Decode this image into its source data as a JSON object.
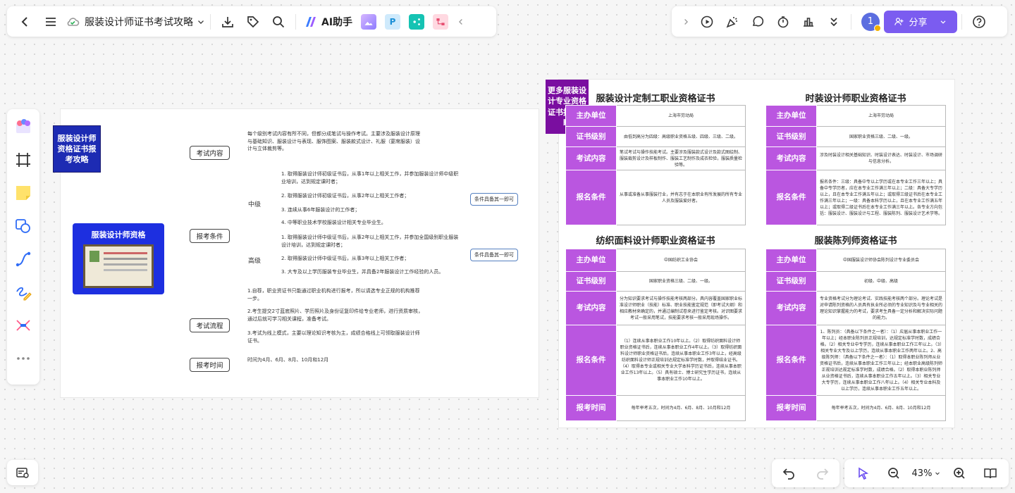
{
  "topbar": {
    "doc_title": "服装设计师证书考试攻略",
    "ai_label": "AI助手",
    "app_p_label": "P",
    "share_label": "分享",
    "avatar_text": "1"
  },
  "zoom": {
    "value": "43%"
  },
  "mindmap": {
    "tag": "服装设计师资格证书报考攻略",
    "root": "服装设计师资格",
    "branches": [
      "考试内容",
      "报考条件",
      "考试流程",
      "报考时间"
    ],
    "content_text": "每个级别考试内容有所不同，但都分成笔试与操作考试。主要涉及服装设计原理与基础知识、服装设计与表现、服饰图案、服装款式设计、礼服（宴席服装）设计与立体裁剪等。",
    "levels": [
      "中级",
      "高级"
    ],
    "mid_items": [
      "1. 取得服装设计师初级证书后，从事1年以上相关工作，并参加服装设计师中级职业培训，达到规定课时者；",
      "2. 取得服装设计师初级证书后，从事2年以上相关工作者；",
      "3. 连续从事6年服装设计的工作者；",
      "4. 中等职业技术学校服装设计相关专业毕业生。"
    ],
    "high_items": [
      "1. 取得服装设计师中级证书后，从事2年以上相关工作，并参加全国级别职业服装设计培训，达到规定课时者；",
      "2. 取得服装设计师中级证书后，从事3年以上相关工作者；",
      "3. 大专及以上学历服装专业毕业生，并具备2年服装设计工作经验的人员。"
    ],
    "pill_mid": "条件具备其一即可",
    "pill_high": "条件具备其一即可",
    "process_items": [
      "1.自荐，职业资证书只能通过职业机构进行报考，所以请选专业正规的机构推荐一步。",
      "2.考生提交2寸蓝底照片、学历照片及身份证复印件给专业老师，进行资质审核，通过后就可学习相关课程，准备考试。",
      "3.考试为线上模式，主要以理论知识考核为主，成绩合格线上可领取服装设计师证书。"
    ],
    "time_text": "时间为4月、6月、8月、10月和12月"
  },
  "certs": {
    "tag": "更多服装设计专业资格证书报考攻略",
    "tables": [
      {
        "title": "服装设计定制工职业资格证书",
        "rows": [
          {
            "label": "主办单位",
            "value": "上海市劳动局"
          },
          {
            "label": "证书级别",
            "value": "由低到高分为四级：高级职业资格五级、四级、三级、二级。"
          },
          {
            "label": "考试内容",
            "value": "笔试考试与操作技能考试。主要涉及服装款式设计及款式图绘制、服装裁剪设计及样板制作、服装工艺制作及成衣检验，服装质量检验等。"
          },
          {
            "label": "报名条件",
            "value": "从事或准备从事服装行业，并有志于在本职业有所发展的所有专业人员及服装爱好者。"
          }
        ]
      },
      {
        "title": "时装设计师职业资格证书",
        "rows": [
          {
            "label": "主办单位",
            "value": "上海市劳动局"
          },
          {
            "label": "证书级别",
            "value": "国家职业资格三级、二级、一级。"
          },
          {
            "label": "考试内容",
            "value": "涉及时装设计相关基础知识、时装设计表达、时装设计、市场调研与信息分析。"
          },
          {
            "label": "报名条件",
            "value": "报名条件：三级：具备中专以上学历或在本专业工作三年以上；具备中专学历者，应在本专业工作满三年以上；二级：具备大专学历以上，且在本专业工作满五年以上；或取得三级证书后在本专业工作满三年以上；一级：具备本科学历以上，且在本专业工作满五年以上；或取得二级证书后在本专业工作满三年以上。各专业方向包括：服装设计、服装设计与工程、服装陈列、服装设计艺术学等。"
          }
        ]
      },
      {
        "title": "纺织面料设计师职业资格证书",
        "rows": [
          {
            "label": "主办单位",
            "value": "中国纺织工业协会"
          },
          {
            "label": "证书级别",
            "value": "国家职业资格三级、二级、一级。"
          },
          {
            "label": "考试内容",
            "value": "分为知识要求考试与操作技能考核两部分。具内容覆盖国家职业标准设计师职业（技能）标准、职业技能鉴定规范（即考试大纲）和相应教材来确定的，并通过编制试卷来进行鉴定考核。对识图要求考试一般采用笔试，技能要求考核一般采用现场操作。"
          },
          {
            "label": "报名条件",
            "value": "（1）连续从事本职业工作10年以上。（2）取得纺织面料设计师职业资格证书后，连续从事本职业工作4年以上。（3）取得纺织面料设计师职业资格证书后，连续从事本职业工作3年以上，经高级纺织面料设计师正规培训达规定标准学时数，并取得结业证书。（4）取得本专业或相关专业大学本科学历证书后，连续从事本职业工作13年以上。（5）具有硕士、博士研究生学历证书，连续从事本职业工作10年以上。"
          },
          {
            "label": "报考时间",
            "value": "每年举考五次，时间为4月、6月、8月、10月和12月"
          }
        ]
      },
      {
        "title": "服装陈列师资格证书",
        "rows": [
          {
            "label": "主办单位",
            "value": "中国服装设计师协会陈列设计专业委员会"
          },
          {
            "label": "证书级别",
            "value": "初级、中级、高级"
          },
          {
            "label": "考试内容",
            "value": "专业资格考试分为理论考试、实践技能考核两个部分。理论考试是对申请陈列资格的人员具有执业所必须的专业知识及与专业相关的理论知识掌握能力的考试，要求考生具备一定分析和解决实际问题的能力。"
          },
          {
            "label": "报名条件",
            "value": "1、陈列员：（具备以下条件之一者）：（1）应届从事本职业工作一年以上；经本职业陈列员正规培训，达规定标准学时数，成绩合格。（2）相关专业中专学历，连续从事本职业工作三年以上。（3）相关专业大专及以上学历，连续从事本职业工作两年以上。2、高级陈列师：（具备以下条件之一者）：（1）取得本职业陈列师从业资格证书后，连续从事本职业工作三年以上；经本职业高级陈列师正规培训达规定标准学时数，成绩合格。（2）取得本职业陈列师从业资格证书后，连续从事本职业工作五年以上。（3）相关专业大专学历，连续从事本职业工作八年以上。（4）相关专业本科及以上学历，连续从事本职业工作五年以上。"
          },
          {
            "label": "报考时间",
            "value": "每年举考五次，时间为4月、6月、8月、10月和12月"
          }
        ]
      }
    ]
  }
}
